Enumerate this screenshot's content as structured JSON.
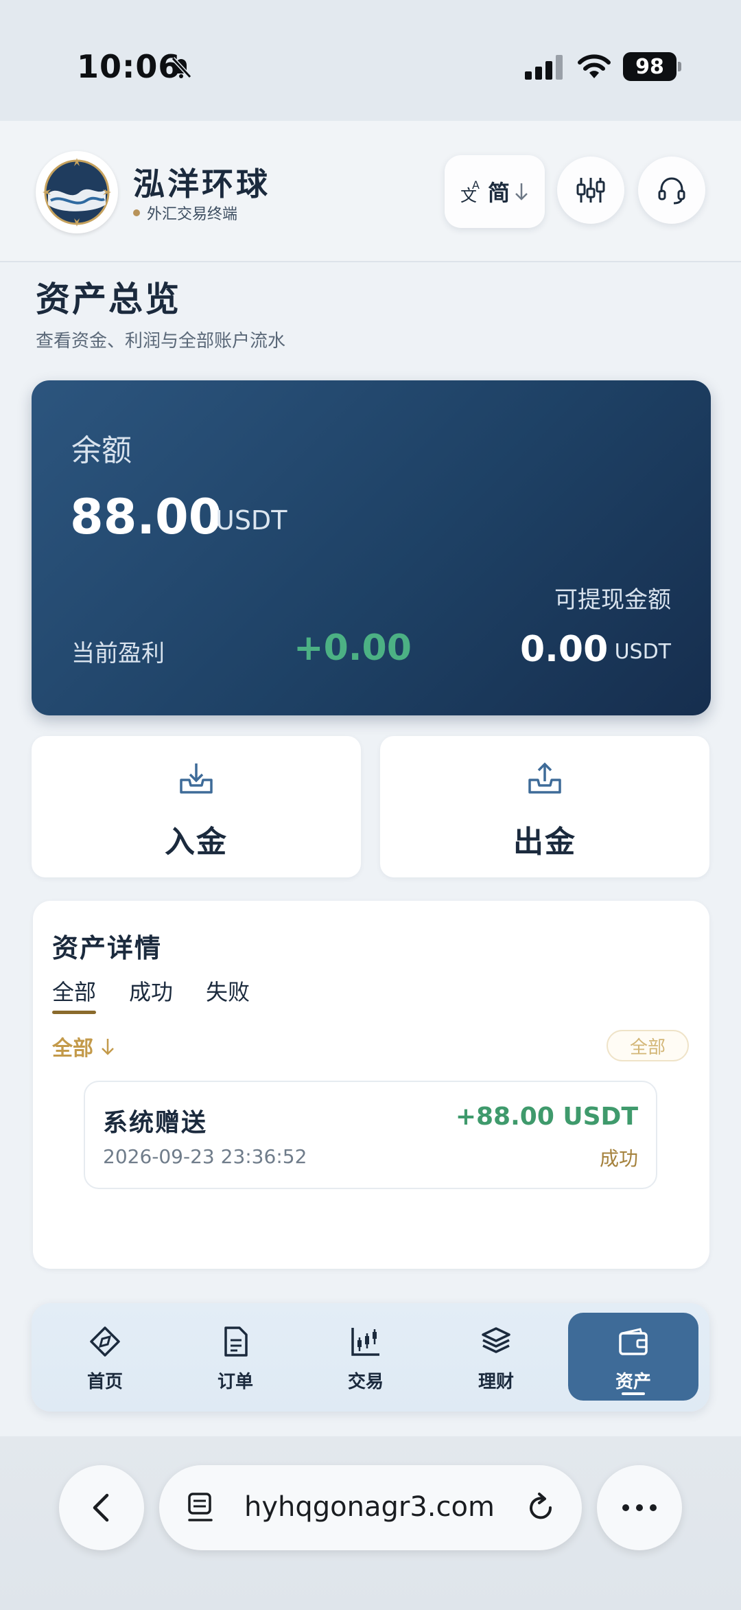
{
  "status_bar": {
    "time": "10:06",
    "battery": "98"
  },
  "header": {
    "brand_name": "泓洋环球",
    "brand_sub": "外汇交易终端",
    "lang_label": "简"
  },
  "page": {
    "title": "资产总览",
    "subtitle": "查看资金、利润与全部账户流水"
  },
  "balance_card": {
    "balance_label": "余额",
    "balance_amount": "88.00",
    "balance_unit": "USDT",
    "profit_label": "当前盈利",
    "profit_value": "+0.00",
    "withdrawable_label": "可提现金额",
    "withdrawable_value": "0.00",
    "withdrawable_unit": "USDT"
  },
  "actions": {
    "deposit": "入金",
    "withdraw": "出金"
  },
  "details": {
    "title": "资产详情",
    "tabs": [
      "全部",
      "成功",
      "失败"
    ],
    "filter_selected": "全部",
    "filter_chip": "全部",
    "transactions": [
      {
        "title": "系统赠送",
        "time": "2026-09-23 23:36:52",
        "amount": "+88.00 USDT",
        "status": "成功"
      }
    ]
  },
  "bottom_nav": {
    "items": [
      {
        "label": "首页",
        "icon": "compass-icon"
      },
      {
        "label": "订单",
        "icon": "document-icon"
      },
      {
        "label": "交易",
        "icon": "candlestick-icon"
      },
      {
        "label": "理财",
        "icon": "layers-icon"
      },
      {
        "label": "资产",
        "icon": "wallet-icon"
      }
    ],
    "active_index": 4
  },
  "browser": {
    "url": "hyhqgonagr3.com"
  },
  "colors": {
    "card_gradient_start": "#2c557e",
    "card_gradient_end": "#162e4e",
    "profit_green": "#4cb184",
    "accent_gold": "#c39a4a",
    "nav_active": "#3e6b98"
  }
}
